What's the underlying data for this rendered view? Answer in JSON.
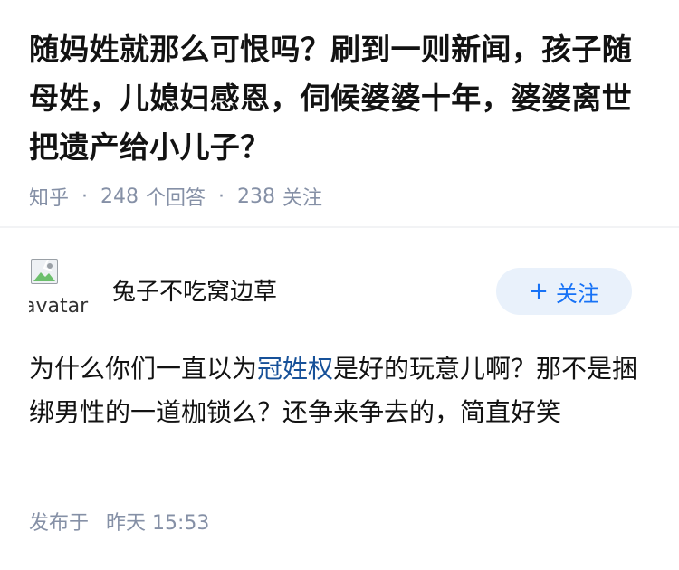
{
  "question": {
    "title": "随妈姓就那么可恨吗？刷到一则新闻，孩子随母姓，儿媳妇感恩，伺候婆婆十年，婆婆离世把遗产给小儿子？",
    "source": "知乎",
    "answer_count": "248",
    "answer_count_label": "个回答",
    "follower_count": "238",
    "follower_count_label": "关注"
  },
  "answer": {
    "avatar_alt": "avatar",
    "author_name": "兔子不吃窝边草",
    "follow_label": "关注",
    "content_before": "为什么你们一直以为",
    "content_link": "冠姓权",
    "content_after": "是好的玩意儿啊？那不是捆绑男性的一道枷锁么？还争来争去的，简直好笑",
    "published_label": "发布于",
    "published_time": "昨天 15:53"
  },
  "colors": {
    "link": "#175199",
    "meta": "#8590a6",
    "follow_bg": "#e9f1fb",
    "follow_text": "#1772f6"
  }
}
